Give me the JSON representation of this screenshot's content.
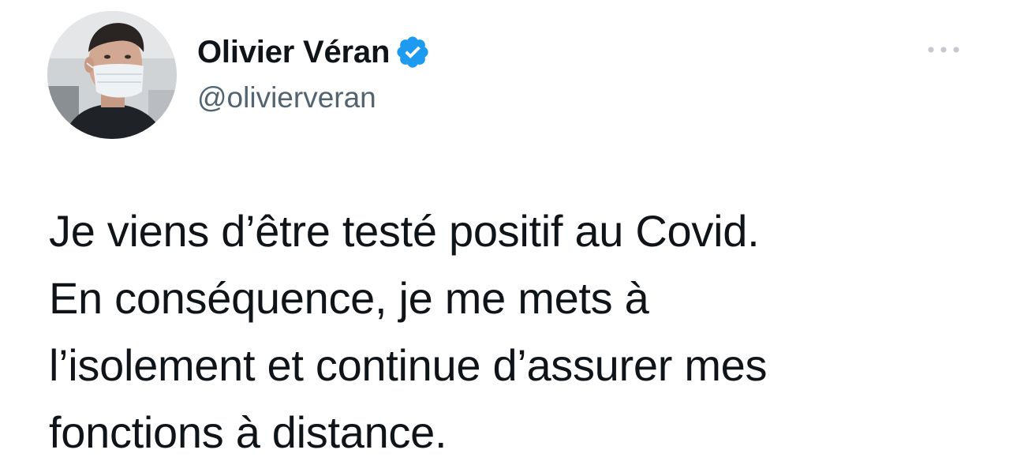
{
  "author": {
    "display_name": "Olivier Véran",
    "handle": "@olivierveran",
    "verified": true,
    "avatar_description": "profile photo"
  },
  "tweet": {
    "lines": [
      "Je viens d’être testé positif au Covid.",
      "En conséquence, je me mets à",
      "l’isolement et continue d’assurer mes",
      "fonctions à distance."
    ]
  },
  "icons": {
    "verified_badge": "verified-badge-icon",
    "more": "more-horizontal-icon"
  },
  "colors": {
    "text_primary": "#0f1419",
    "text_secondary": "#536471",
    "verified_blue": "#1d9bf0",
    "background": "#ffffff"
  }
}
